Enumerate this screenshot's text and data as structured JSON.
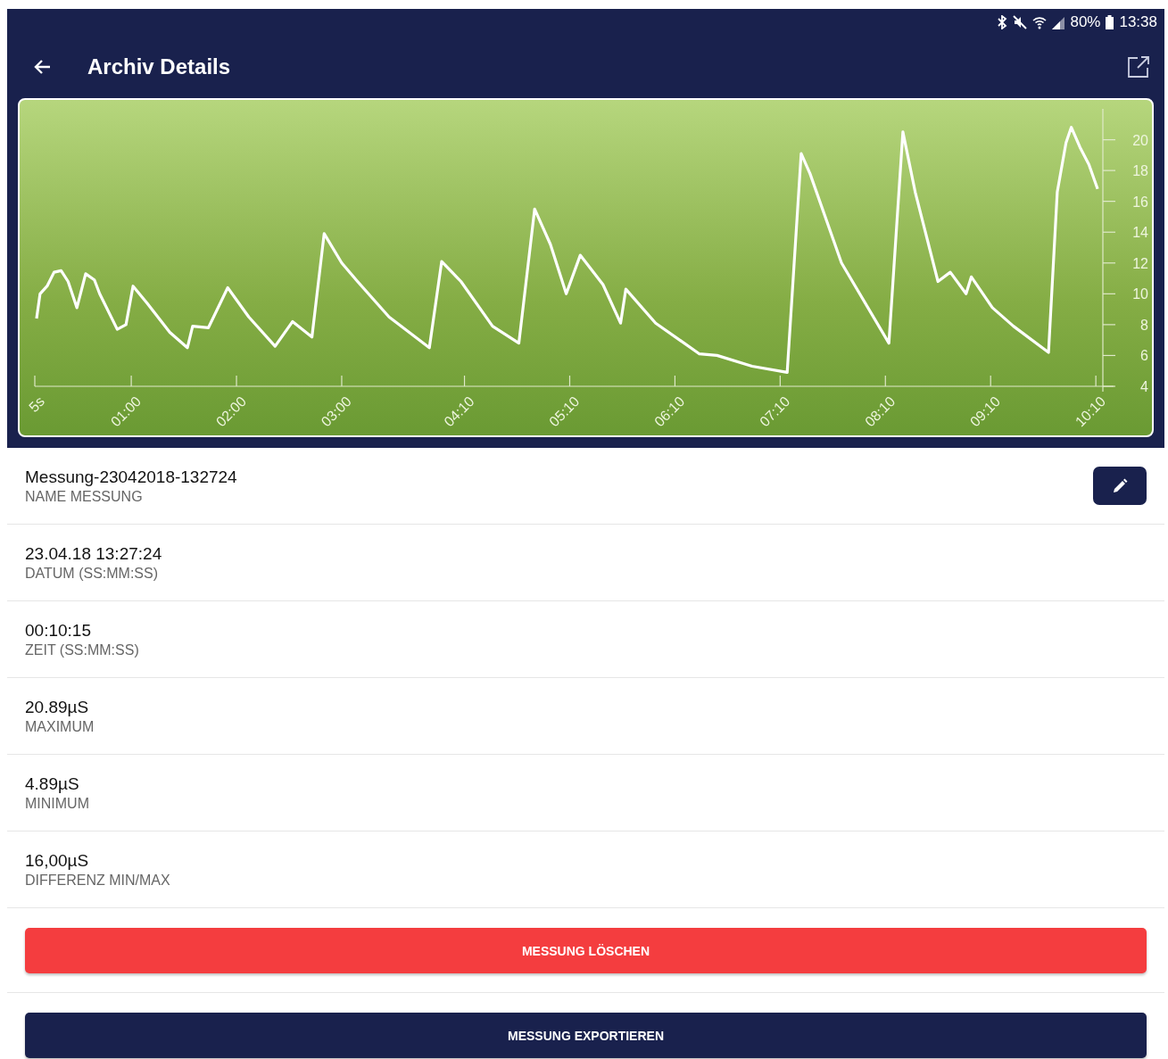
{
  "status_bar": {
    "battery": "80%",
    "time": "13:38"
  },
  "app_bar": {
    "title": "Archiv Details"
  },
  "chart_data": {
    "type": "line",
    "xlim": [
      5,
      614
    ],
    "ylim": [
      4,
      22
    ],
    "xticks": [
      {
        "value": 5,
        "label": "5s"
      },
      {
        "value": 60,
        "label": "01:00"
      },
      {
        "value": 120,
        "label": "02:00"
      },
      {
        "value": 180,
        "label": "03:00"
      },
      {
        "value": 250,
        "label": "04:10"
      },
      {
        "value": 310,
        "label": "05:10"
      },
      {
        "value": 370,
        "label": "06:10"
      },
      {
        "value": 430,
        "label": "07:10"
      },
      {
        "value": 490,
        "label": "08:10"
      },
      {
        "value": 550,
        "label": "09:10"
      },
      {
        "value": 610,
        "label": "10:10"
      }
    ],
    "yticks": [
      4,
      6,
      8,
      10,
      12,
      14,
      16,
      18,
      20
    ],
    "x": [
      6,
      8,
      12,
      16,
      20,
      24,
      29,
      34,
      39,
      42,
      52,
      57,
      61,
      69,
      82,
      92,
      95,
      104,
      115,
      127,
      142,
      152,
      163,
      170,
      180,
      189,
      207,
      230,
      237,
      248,
      266,
      281,
      290,
      299,
      308,
      316,
      329,
      339,
      342,
      359,
      384,
      394,
      414,
      434,
      442,
      447,
      465,
      492,
      500,
      507,
      520,
      527,
      536,
      539,
      551,
      563,
      583,
      588,
      593,
      596,
      601,
      606,
      611
    ],
    "series": [
      {
        "color": "#ffffff",
        "values": [
          8.4,
          10,
          10.5,
          11.4,
          11.5,
          10.8,
          9.1,
          11.3,
          10.9,
          10,
          7.7,
          8,
          10.5,
          9.4,
          7.5,
          6.5,
          7.9,
          7.8,
          10.4,
          8.5,
          6.6,
          8.2,
          7.2,
          13.9,
          12,
          10.8,
          8.5,
          6.5,
          12.1,
          10.8,
          7.9,
          6.8,
          15.5,
          13.2,
          10,
          12.5,
          10.6,
          8.1,
          10.3,
          8.1,
          6.1,
          6,
          5.3,
          4.9,
          19.1,
          17.8,
          12,
          6.8,
          20.5,
          16.6,
          10.8,
          11.4,
          10,
          11.1,
          9.1,
          7.9,
          6.2,
          16.6,
          19.8,
          20.8,
          19.5,
          18.4,
          16.8
        ]
      }
    ]
  },
  "details": [
    {
      "value": "Messung-23042018-132724",
      "label": "NAME MESSUNG",
      "editable": true
    },
    {
      "value": "23.04.18 13:27:24",
      "label": "DATUM (SS:MM:SS)",
      "editable": false
    },
    {
      "value": "00:10:15",
      "label": "ZEIT (SS:MM:SS)",
      "editable": false
    },
    {
      "value": "20.89µS",
      "label": "MAXIMUM",
      "editable": false
    },
    {
      "value": "4.89µS",
      "label": "MINIMUM",
      "editable": false
    },
    {
      "value": "16,00µS",
      "label": "DIFFERENZ MIN/MAX",
      "editable": false
    }
  ],
  "actions": [
    {
      "label": "MESSUNG LÖSCHEN",
      "kind": "danger"
    },
    {
      "label": "MESSUNG EXPORTIEREN",
      "kind": "primary"
    }
  ]
}
